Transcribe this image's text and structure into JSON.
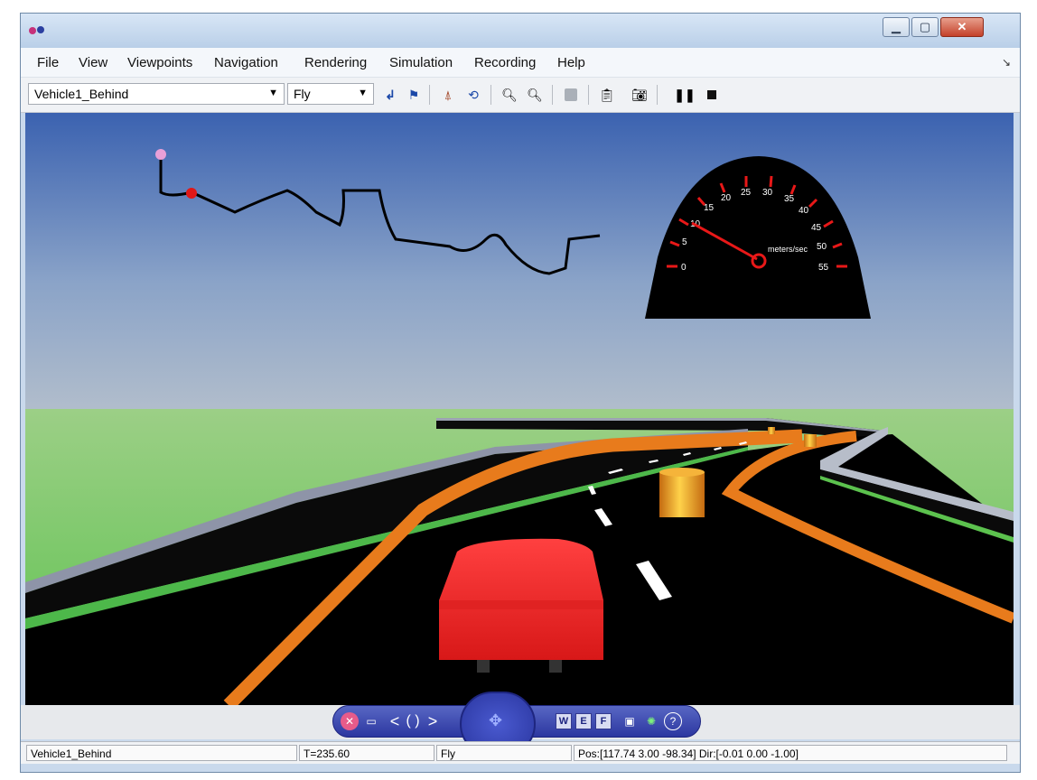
{
  "window": {
    "title": ""
  },
  "menu": [
    "File",
    "View",
    "Viewpoints",
    "Navigation",
    "Rendering",
    "Simulation",
    "Recording",
    "Help"
  ],
  "toolbar": {
    "viewpoint": "Vehicle1_Behind",
    "navigation_mode": "Fly",
    "buttons": [
      "go-to-viewpoint-icon",
      "flag-icon",
      "straighten-up-icon",
      "restore-icon",
      "zoom-in-icon",
      "zoom-out-icon",
      "stop-icon",
      "edit-icon",
      "snapshot-icon",
      "pause-icon",
      "stop-square-icon"
    ]
  },
  "gauge": {
    "unit_label": "meters/sec",
    "ticks": [
      "0",
      "5",
      "10",
      "15",
      "20",
      "25",
      "30",
      "35",
      "40",
      "45",
      "50",
      "55"
    ],
    "needle_value": 10
  },
  "nav_panel": {
    "w_label": "W",
    "e_label": "E",
    "f_label": "F",
    "help_label": "?"
  },
  "status": {
    "viewpoint": "Vehicle1_Behind",
    "time": "T=235.60",
    "mode": "Fly",
    "position": "Pos:[117.74 3.00 -98.34] Dir:[-0.01 0.00 -1.00]"
  },
  "colors": {
    "sky_top": "#3b62b0",
    "ground": "#6bc660",
    "road": "#000000",
    "edge_line": "#e87b1c",
    "car": "#ef2222",
    "barrel": "#f4a020"
  }
}
